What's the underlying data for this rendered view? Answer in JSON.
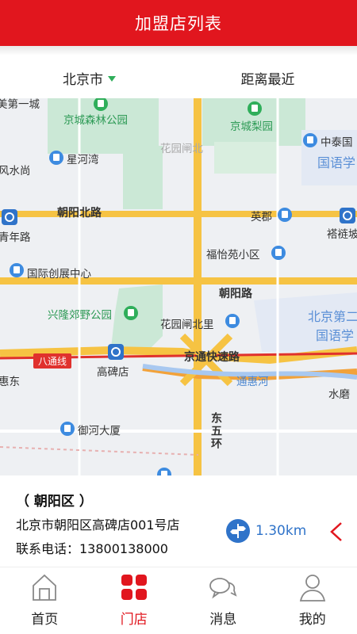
{
  "header": {
    "title": "加盟店列表"
  },
  "filters": {
    "city": "北京市",
    "sort": "距离最近"
  },
  "map": {
    "labels": {
      "mei_first_city": "美第一城",
      "jingcheng_forest": "京城森林公园",
      "jingcheng_pear": "京城梨园",
      "huayuan_jun": "花园闸北",
      "xinghewan": "星河湾",
      "zhongtai": "中泰国",
      "guoyu_school1": "国语学",
      "fengshuishang": "风水尚",
      "chaoyang_north_road": "朝阳北路",
      "yingjun": "英郡",
      "tajita": "褡裢坡",
      "qingnian_road": "青年路",
      "fuyiyuan": "福怡苑小区",
      "intl_center": "国际创展中心",
      "chaoyang_road": "朝阳路",
      "xinglong_park": "兴隆郊野公园",
      "huayuan_beili": "花园闸北里",
      "beijing_second": "北京第二",
      "guoyu_school2": "国语学",
      "batong_line": "八通线",
      "gaobeidian": "高碑店",
      "jingtong_expressway": "京通快速路",
      "huidong": "惠东",
      "tonghui_river": "通惠河",
      "shuimo": "水磨",
      "yuhe_mansion": "御河大厦",
      "east_fifth_ring": "东五环"
    }
  },
  "store": {
    "district": "（ 朝阳区 ）",
    "address": "北京市朝阳区高碑店001号店",
    "phone": "联系电话：13800138000",
    "distance": "1.30km"
  },
  "tabs": [
    {
      "label": "首页",
      "icon": "home-icon"
    },
    {
      "label": "门店",
      "icon": "store-grid-icon"
    },
    {
      "label": "消息",
      "icon": "message-icon"
    },
    {
      "label": "我的",
      "icon": "profile-icon"
    }
  ],
  "colors": {
    "brand": "#e1161e",
    "accent_blue": "#2f73c9",
    "accent_green": "#2fae5a"
  }
}
